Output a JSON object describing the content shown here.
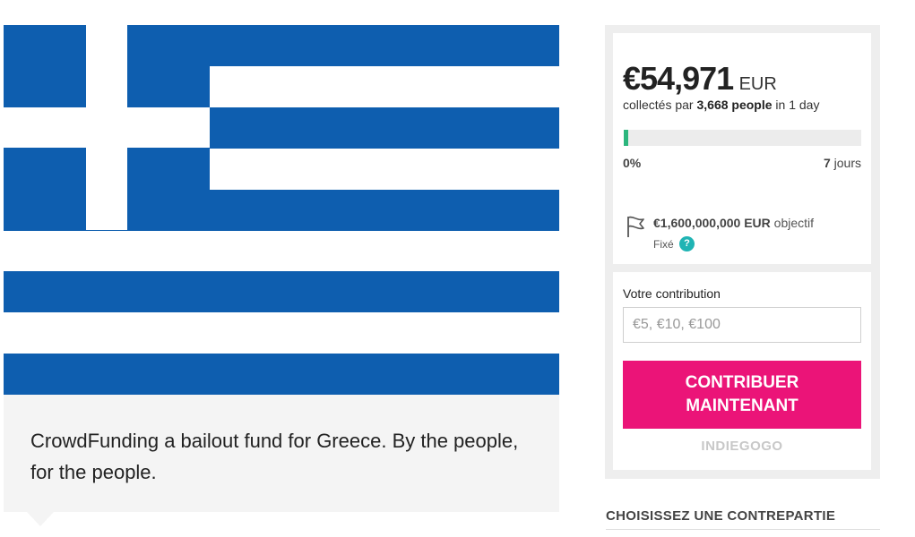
{
  "campaign": {
    "description": "CrowdFunding a bailout fund for Greece. By the people, for the people."
  },
  "funding": {
    "amount": "€54,971",
    "currency": "EUR",
    "raised_prefix": "collectés par",
    "backers": "3,668 people",
    "duration": "in 1 day",
    "progress_label": "0%",
    "progress_fraction": 0.003,
    "days_value": "7",
    "days_unit": "jours",
    "goal_amount": "€1,600,000,000 EUR",
    "goal_suffix": "objectif",
    "goal_type": "Fixé",
    "help_symbol": "?",
    "accent_color": "#2cb67d"
  },
  "contribution": {
    "label": "Votre contribution",
    "placeholder": "€5, €10, €100",
    "button_label": "CONTRIBUER MAINTENANT",
    "button_color": "#eb1478",
    "brand": "INDIEGOGO"
  },
  "perks": {
    "heading": "CHOISISSEZ UNE CONTREPARTIE"
  },
  "flag": {
    "blue": "#0e5eaf",
    "white": "#ffffff"
  },
  "icons": {
    "goal": "flag-outline-icon",
    "help": "question-circle-icon"
  }
}
